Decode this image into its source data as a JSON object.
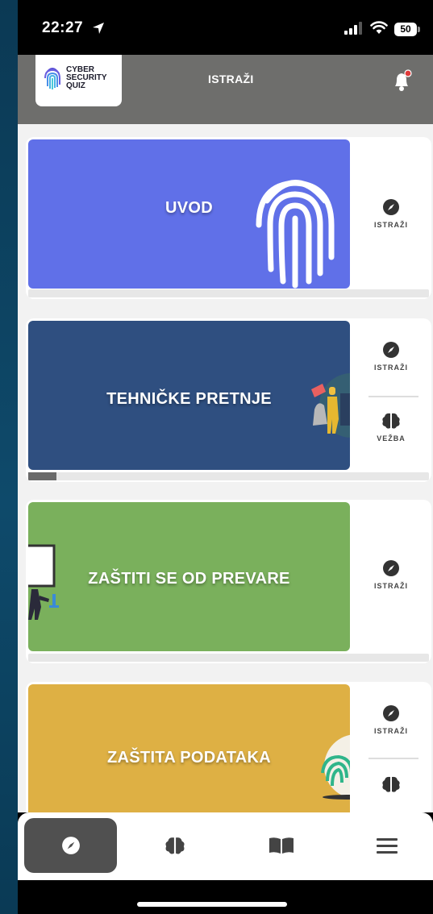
{
  "status_bar": {
    "time": "22:27",
    "battery": "50"
  },
  "header": {
    "logo_line1": "CYBER",
    "logo_line2": "SECURITY",
    "logo_line3": "QUIZ",
    "title": "ISTRAŽI"
  },
  "cards": [
    {
      "title": "UVOD",
      "color": "#6070e8",
      "explore_label": "ISTRAŽI"
    },
    {
      "title": "TEHNIČKE PRETNJE",
      "color": "#2f4f80",
      "explore_label": "ISTRAŽI",
      "practice_label": "VEŽBA",
      "progress": 0.07
    },
    {
      "title": "ZAŠTITI SE OD PREVARE",
      "color": "#7ab05c",
      "explore_label": "ISTRAŽI"
    },
    {
      "title": "ZAŠTITA PODATAKA",
      "color": "#deb044",
      "explore_label": "ISTRAŽI"
    }
  ],
  "nav": {
    "items": [
      {
        "icon": "compass-icon",
        "active": true
      },
      {
        "icon": "brain-icon",
        "active": false
      },
      {
        "icon": "book-icon",
        "active": false
      },
      {
        "icon": "menu-icon",
        "active": false
      }
    ]
  },
  "colors": {
    "accent_notification": "#e03a3a",
    "nav_active": "#505050"
  }
}
